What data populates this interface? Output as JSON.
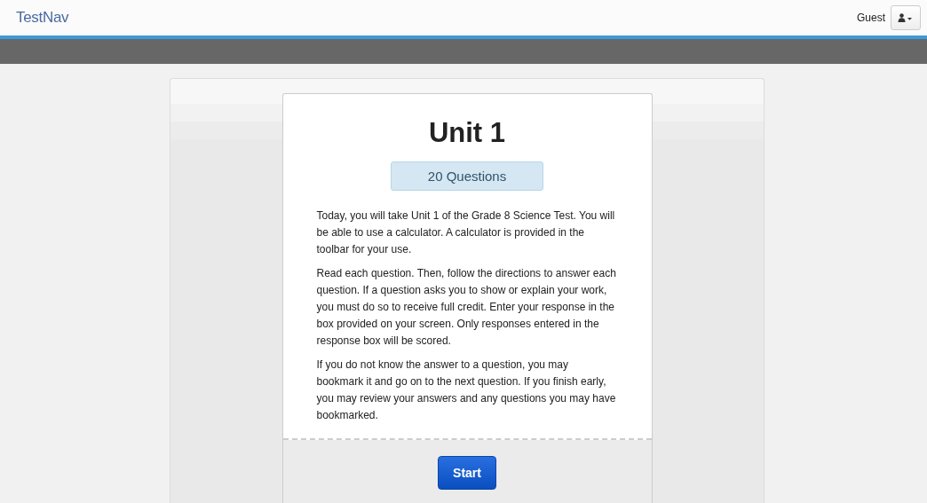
{
  "header": {
    "logo": "TestNav",
    "user": "Guest"
  },
  "unit": {
    "title": "Unit 1",
    "question_count": "20 Questions",
    "paragraphs": [
      "Today, you will take Unit 1 of the Grade 8 Science Test. You will be able to use a calculator. A calculator is provided in the toolbar for your use.",
      "Read each question. Then, follow the directions to answer each question. If a question asks you to show or explain your work, you must do so to receive full credit. Enter your response in the box provided on your screen. Only responses entered in the response box will be scored.",
      "If you do not know the answer to a question, you may bookmark it and go on to the next question. If you finish early, you may review your answers and any questions you may have bookmarked."
    ],
    "start_button": "Start"
  }
}
